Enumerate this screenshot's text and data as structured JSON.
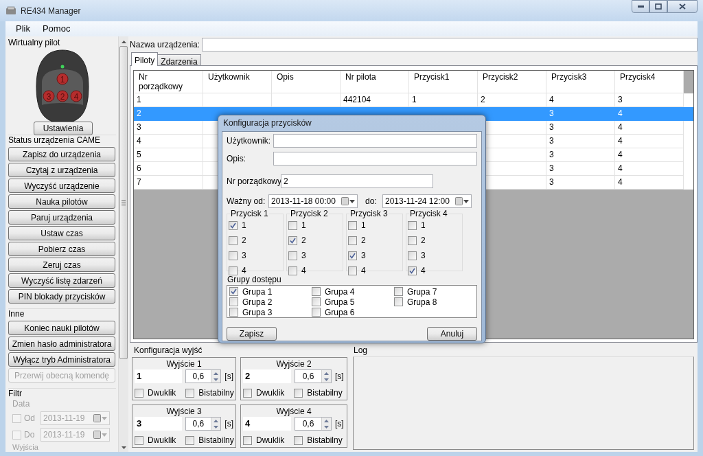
{
  "window": {
    "title": "RE434 Manager"
  },
  "menu": [
    {
      "label": "Plik"
    },
    {
      "label": "Pomoc"
    }
  ],
  "left_panel": {
    "virtual_remote": {
      "title": "Wirtualny pilot",
      "keys": [
        "1",
        "3",
        "2",
        "4"
      ],
      "settings_button": "Ustawienia"
    },
    "sections": [
      {
        "title": "Status urządzenia CAME",
        "buttons": [
          {
            "label": "Zapisz do urządzenia",
            "disabled": false
          },
          {
            "label": "Czytaj z urządzenia",
            "disabled": false
          },
          {
            "label": "Wyczyść urządzenie",
            "disabled": false
          },
          {
            "label": "Nauka pilotów",
            "disabled": false
          },
          {
            "label": "Paruj urządzenia",
            "disabled": false
          },
          {
            "label": "Ustaw czas",
            "disabled": false
          },
          {
            "label": "Pobierz czas",
            "disabled": false
          },
          {
            "label": "Zeruj czas",
            "disabled": false
          },
          {
            "label": "Wyczyść listę zdarzeń",
            "disabled": false
          },
          {
            "label": "PIN blokady przycisków",
            "disabled": false
          }
        ]
      },
      {
        "title": "Inne",
        "buttons": [
          {
            "label": "Koniec nauki pilotów",
            "disabled": false
          },
          {
            "label": "Zmien hasło administratora",
            "disabled": false
          },
          {
            "label": "Wyłącz tryb Administratora",
            "disabled": false
          },
          {
            "label": "Przerwij obecną komendę",
            "disabled": true
          }
        ]
      }
    ],
    "filter": {
      "title": "Filtr",
      "date": {
        "title": "Data",
        "disabled": true,
        "rows": [
          {
            "label": "Od",
            "checked": false,
            "value": "2013-11-19"
          },
          {
            "label": "Do",
            "checked": false,
            "value": "2013-11-19"
          }
        ]
      },
      "outputs_title": "Wyjścia"
    }
  },
  "device_name": {
    "label": "Nazwa urządzenia:"
  },
  "tabs": [
    {
      "label": "Piloty",
      "selected": true
    },
    {
      "label": "Zdarzenia",
      "selected": false
    }
  ],
  "table": {
    "columns": [
      "Nr porządkowy",
      "Użytkownik",
      "Opis",
      "Nr pilota",
      "Przycisk1",
      "Przycisk2",
      "Przycisk3",
      "Przycisk4"
    ],
    "rows": [
      {
        "selected": false,
        "cells": [
          "1",
          null,
          null,
          "442104",
          "1",
          "2",
          "4",
          "3"
        ]
      },
      {
        "selected": true,
        "cells": [
          "2",
          null,
          null,
          null,
          null,
          null,
          "3",
          "4"
        ]
      },
      {
        "selected": false,
        "cells": [
          "3",
          null,
          null,
          null,
          null,
          null,
          "3",
          "4"
        ]
      },
      {
        "selected": false,
        "cells": [
          "4",
          null,
          null,
          null,
          null,
          null,
          "3",
          "4"
        ]
      },
      {
        "selected": false,
        "cells": [
          "5",
          null,
          null,
          null,
          null,
          null,
          "3",
          "4"
        ]
      },
      {
        "selected": false,
        "cells": [
          "6",
          null,
          null,
          null,
          null,
          null,
          "3",
          "4"
        ]
      },
      {
        "selected": false,
        "cells": [
          "7",
          null,
          null,
          null,
          null,
          null,
          "3",
          "4"
        ]
      }
    ]
  },
  "outputs": {
    "title": "Konfiguracja wyjść",
    "items": [
      {
        "title": "Wyjście 1",
        "name": "1",
        "time": "0,6",
        "unit": "[s]",
        "options": [
          {
            "label": "Dwuklik",
            "checked": false
          },
          {
            "label": "Bistabilny",
            "checked": false
          }
        ]
      },
      {
        "title": "Wyjście 2",
        "name": "2",
        "time": "0,6",
        "unit": "[s]",
        "options": [
          {
            "label": "Dwuklik",
            "checked": false
          },
          {
            "label": "Bistabilny",
            "checked": false
          }
        ]
      },
      {
        "title": "Wyjście 3",
        "name": "3",
        "time": "0,6",
        "unit": "[s]",
        "options": [
          {
            "label": "Dwuklik",
            "checked": false
          },
          {
            "label": "Bistabilny",
            "checked": false
          }
        ]
      },
      {
        "title": "Wyjście 4",
        "name": "4",
        "time": "0,6",
        "unit": "[s]",
        "options": [
          {
            "label": "Dwuklik",
            "checked": false
          },
          {
            "label": "Bistabilny",
            "checked": false
          }
        ]
      }
    ]
  },
  "log": {
    "title": "Log"
  },
  "dialog": {
    "title": "Konfiguracja przycisków",
    "fields": [
      {
        "label": "Użytkownik:"
      },
      {
        "label": "Opis:"
      }
    ],
    "order_number": {
      "label": "Nr porządkowy",
      "value": "2"
    },
    "valid_from": {
      "label": "Ważny od:",
      "value": "2013-11-18 00:00"
    },
    "valid_to": {
      "label": "do:",
      "value": "2013-11-24 12:00"
    },
    "button_groups": [
      {
        "title": "Przycisk 1",
        "options": [
          {
            "label": "1",
            "checked": true
          },
          {
            "label": "2",
            "checked": false
          },
          {
            "label": "3",
            "checked": false
          },
          {
            "label": "4",
            "checked": false
          }
        ]
      },
      {
        "title": "Przycisk 2",
        "options": [
          {
            "label": "1",
            "checked": false
          },
          {
            "label": "2",
            "checked": true
          },
          {
            "label": "3",
            "checked": false
          },
          {
            "label": "4",
            "checked": false
          }
        ]
      },
      {
        "title": "Przycisk 3",
        "options": [
          {
            "label": "1",
            "checked": false
          },
          {
            "label": "2",
            "checked": false
          },
          {
            "label": "3",
            "checked": true
          },
          {
            "label": "4",
            "checked": false
          }
        ]
      },
      {
        "title": "Przycisk 4",
        "options": [
          {
            "label": "1",
            "checked": false
          },
          {
            "label": "2",
            "checked": false
          },
          {
            "label": "3",
            "checked": false
          },
          {
            "label": "4",
            "checked": true
          }
        ]
      }
    ],
    "access_groups": {
      "title": "Grupy dostępu",
      "items": [
        {
          "label": "Grupa 1",
          "checked": true
        },
        {
          "label": "Grupa 2",
          "checked": false
        },
        {
          "label": "Grupa 3",
          "checked": false
        },
        {
          "label": "Grupa 4",
          "checked": false
        },
        {
          "label": "Grupa 5",
          "checked": false
        },
        {
          "label": "Grupa 6",
          "checked": false
        },
        {
          "label": "Grupa 7",
          "checked": false
        },
        {
          "label": "Grupa 8",
          "checked": false
        }
      ]
    },
    "buttons": [
      {
        "label": "Zapisz"
      },
      {
        "label": "Anuluj"
      }
    ]
  }
}
